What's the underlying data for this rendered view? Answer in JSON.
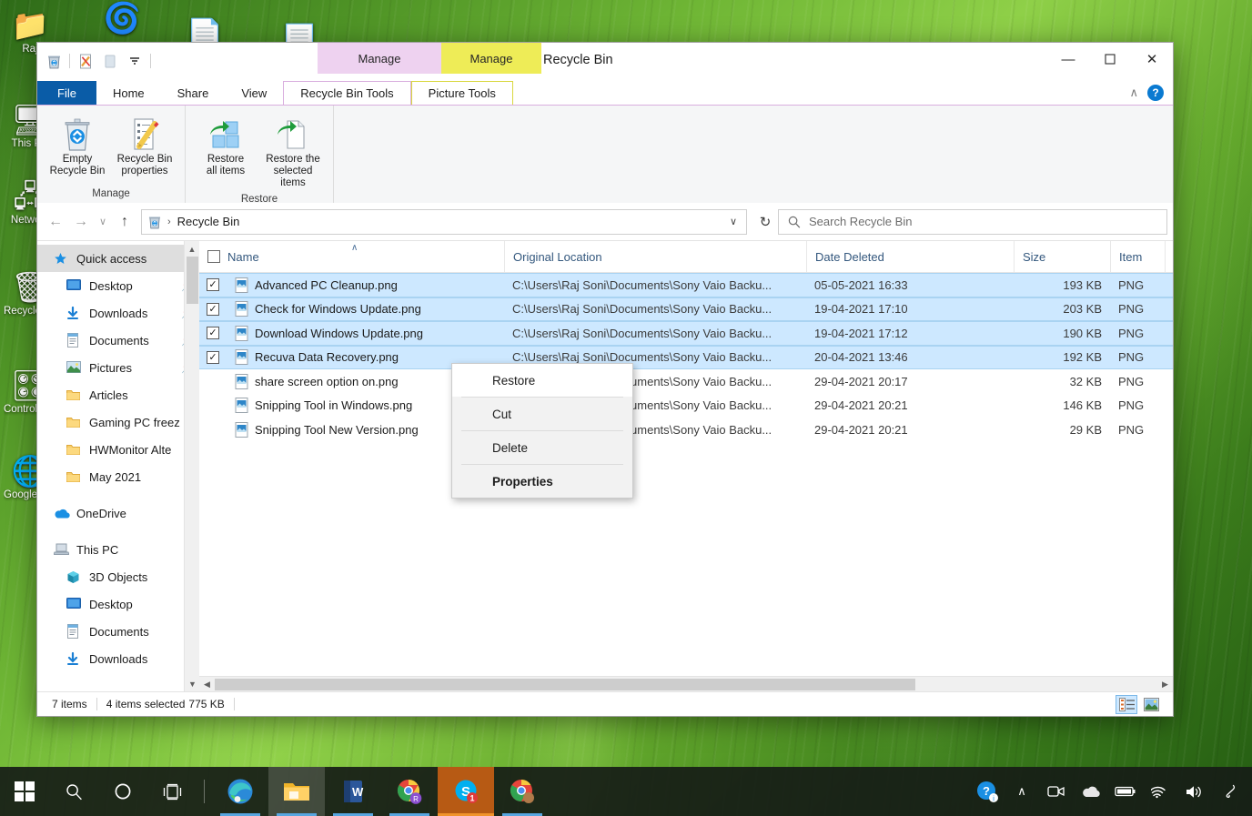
{
  "desktop": {
    "icons": [
      {
        "name": "folder-raj",
        "label": "Raj",
        "glyph": "📁"
      },
      {
        "name": "this-pc",
        "label": "This PC",
        "glyph": "🖥"
      },
      {
        "name": "network",
        "label": "Network",
        "glyph": "🖧"
      },
      {
        "name": "recycle-bin",
        "label": "Recycle Bin",
        "glyph": "🗑"
      },
      {
        "name": "control-panel",
        "label": "Control Panel",
        "glyph": "🎛"
      },
      {
        "name": "google-chrome",
        "label": "Google Chrome",
        "glyph": "🌐"
      }
    ],
    "top_icons": [
      {
        "name": "microsoft-edge",
        "label": "",
        "glyph": "🌀"
      },
      {
        "name": "document-thumbnail-1",
        "label": "",
        "glyph": "📄"
      },
      {
        "name": "document-thumbnail-2",
        "label": "",
        "glyph": "📃"
      }
    ]
  },
  "window": {
    "title": "Recycle Bin",
    "quick_access_toolbar": [
      {
        "name": "recycle-bin-icon",
        "tooltip": "Recycle Bin"
      },
      {
        "name": "properties-icon",
        "tooltip": "Properties"
      },
      {
        "name": "new-folder-icon",
        "tooltip": "New folder"
      },
      {
        "name": "customize-quick-access-icon",
        "tooltip": "Customize Quick Access Toolbar"
      }
    ],
    "controls": {
      "minimize": "—",
      "maximize": "☐",
      "close": "✕"
    },
    "contextual_groups": [
      {
        "label": "Manage",
        "color": "#eed2f0"
      },
      {
        "label": "Manage",
        "color": "#eeec57"
      }
    ],
    "tabs": [
      {
        "label": "File",
        "state": "file"
      },
      {
        "label": "Home",
        "state": "normal"
      },
      {
        "label": "Share",
        "state": "normal"
      },
      {
        "label": "View",
        "state": "normal"
      },
      {
        "label": "Recycle Bin Tools",
        "state": "active-pink"
      },
      {
        "label": "Picture Tools",
        "state": "active-yellow"
      }
    ],
    "ribbon_collapse": "∧",
    "help": "?"
  },
  "ribbon": {
    "groups": [
      {
        "name": "Manage",
        "buttons": [
          {
            "name": "empty-recycle-bin-button",
            "line1": "Empty",
            "line2": "Recycle Bin",
            "icon": "recycle-bin-icon"
          },
          {
            "name": "recycle-bin-properties-button",
            "line1": "Recycle Bin",
            "line2": "properties",
            "icon": "properties-icon"
          }
        ]
      },
      {
        "name": "Restore",
        "buttons": [
          {
            "name": "restore-all-items-button",
            "line1": "Restore",
            "line2": "all items",
            "icon": "restore-all-icon"
          },
          {
            "name": "restore-selected-items-button",
            "line1": "Restore the",
            "line2": "selected items",
            "icon": "restore-selected-icon"
          }
        ]
      }
    ]
  },
  "address": {
    "back": "←",
    "forward": "→",
    "recent": "∨",
    "up": "↑",
    "crumb_icon": "recycle-bin-icon",
    "crumb_sep": "›",
    "crumb": "Recycle Bin",
    "dropdown": "∨",
    "refresh": "↻"
  },
  "search": {
    "placeholder": "Search Recycle Bin",
    "value": "",
    "icon": "search-icon"
  },
  "nav_pane": {
    "items": [
      {
        "name": "sidebar-item-quick-access",
        "label": "Quick access",
        "icon": "star-pin-icon",
        "level": 0,
        "selected": true,
        "pinned": false
      },
      {
        "name": "sidebar-item-desktop",
        "label": "Desktop",
        "icon": "desktop-icon",
        "level": 1,
        "selected": false,
        "pinned": true
      },
      {
        "name": "sidebar-item-downloads",
        "label": "Downloads",
        "icon": "download-icon",
        "level": 1,
        "selected": false,
        "pinned": true
      },
      {
        "name": "sidebar-item-documents",
        "label": "Documents",
        "icon": "documents-icon",
        "level": 1,
        "selected": false,
        "pinned": true
      },
      {
        "name": "sidebar-item-pictures",
        "label": "Pictures",
        "icon": "pictures-icon",
        "level": 1,
        "selected": false,
        "pinned": true
      },
      {
        "name": "sidebar-item-articles",
        "label": "Articles",
        "icon": "folder-icon",
        "level": 1,
        "selected": false,
        "pinned": false
      },
      {
        "name": "sidebar-item-gaming-pc-freez",
        "label": "Gaming PC freez",
        "icon": "folder-icon",
        "level": 1,
        "selected": false,
        "pinned": false
      },
      {
        "name": "sidebar-item-hwmonitor-alte",
        "label": "HWMonitor Alte",
        "icon": "folder-icon",
        "level": 1,
        "selected": false,
        "pinned": false
      },
      {
        "name": "sidebar-item-may-2021",
        "label": "May 2021",
        "icon": "folder-icon",
        "level": 1,
        "selected": false,
        "pinned": false
      },
      {
        "name": "sidebar-item-onedrive",
        "label": "OneDrive",
        "icon": "onedrive-icon",
        "level": 0,
        "selected": false,
        "pinned": false,
        "spacer": true
      },
      {
        "name": "sidebar-item-this-pc",
        "label": "This PC",
        "icon": "this-pc-icon",
        "level": 0,
        "selected": false,
        "pinned": false,
        "spacer": true
      },
      {
        "name": "sidebar-item-3d-objects",
        "label": "3D Objects",
        "icon": "3d-objects-icon",
        "level": 1,
        "selected": false,
        "pinned": false
      },
      {
        "name": "sidebar-item-desktop-pc",
        "label": "Desktop",
        "icon": "desktop-icon",
        "level": 1,
        "selected": false,
        "pinned": false
      },
      {
        "name": "sidebar-item-documents-pc",
        "label": "Documents",
        "icon": "documents-icon",
        "level": 1,
        "selected": false,
        "pinned": false
      },
      {
        "name": "sidebar-item-downloads-pc",
        "label": "Downloads",
        "icon": "download-icon",
        "level": 1,
        "selected": false,
        "pinned": false
      }
    ]
  },
  "file_list": {
    "columns": [
      {
        "name": "column-name",
        "label": "Name",
        "sorted": true
      },
      {
        "name": "column-original-location",
        "label": "Original Location",
        "sorted": false
      },
      {
        "name": "column-date-deleted",
        "label": "Date Deleted",
        "sorted": false
      },
      {
        "name": "column-size",
        "label": "Size",
        "sorted": false
      },
      {
        "name": "column-item-type",
        "label": "Item",
        "sorted": false
      }
    ],
    "rows": [
      {
        "name": "Advanced PC Cleanup.png",
        "location": "C:\\Users\\Raj Soni\\Documents\\Sony Vaio Backu...",
        "date": "05-05-2021 16:33",
        "size": "193 KB",
        "type": "PNG",
        "selected": true,
        "checked": true
      },
      {
        "name": "Check for Windows Update.png",
        "location": "C:\\Users\\Raj Soni\\Documents\\Sony Vaio Backu...",
        "date": "19-04-2021 17:10",
        "size": "203 KB",
        "type": "PNG",
        "selected": true,
        "checked": true
      },
      {
        "name": "Download Windows Update.png",
        "location": "C:\\Users\\Raj Soni\\Documents\\Sony Vaio Backu...",
        "date": "19-04-2021 17:12",
        "size": "190 KB",
        "type": "PNG",
        "selected": true,
        "checked": true
      },
      {
        "name": "Recuva Data Recovery.png",
        "location": "C:\\Users\\Raj Soni\\Documents\\Sony Vaio Backu...",
        "date": "20-04-2021 13:46",
        "size": "192 KB",
        "type": "PNG",
        "selected": true,
        "checked": true
      },
      {
        "name": "share screen option on.png",
        "location": "C:\\Users\\Raj Soni\\Documents\\Sony Vaio Backu...",
        "date": "29-04-2021 20:17",
        "size": "32 KB",
        "type": "PNG",
        "selected": false,
        "checked": false
      },
      {
        "name": "Snipping Tool in Windows.png",
        "location": "C:\\Users\\Raj Soni\\Documents\\Sony Vaio Backu...",
        "date": "29-04-2021 20:21",
        "size": "146 KB",
        "type": "PNG",
        "selected": false,
        "checked": false
      },
      {
        "name": "Snipping Tool New Version.png",
        "location": "C:\\Users\\Raj Soni\\Documents\\Sony Vaio Backu...",
        "date": "29-04-2021 20:21",
        "size": "29 KB",
        "type": "PNG",
        "selected": false,
        "checked": false
      }
    ]
  },
  "context_menu": {
    "items": [
      {
        "name": "context-menu-restore",
        "label": "Restore",
        "bold": false,
        "highlighted": true
      },
      {
        "name": "context-menu-cut",
        "label": "Cut",
        "bold": false,
        "highlighted": false
      },
      {
        "name": "context-menu-delete",
        "label": "Delete",
        "bold": false,
        "highlighted": false
      },
      {
        "name": "context-menu-properties",
        "label": "Properties",
        "bold": true,
        "highlighted": false
      }
    ]
  },
  "status_bar": {
    "item_count": "7 items",
    "selection": "4 items selected",
    "selection_size": "775 KB",
    "views": [
      {
        "name": "details-view-button",
        "label": "Details view",
        "active": true
      },
      {
        "name": "large-icons-view-button",
        "label": "Large icons view",
        "active": false
      }
    ]
  },
  "taskbar": {
    "start": {
      "name": "start-button",
      "label": "Start"
    },
    "buttons": [
      {
        "name": "search-taskbar-icon",
        "label": "Search",
        "glyph": "search"
      },
      {
        "name": "cortana-icon",
        "label": "Cortana",
        "glyph": "circle"
      },
      {
        "name": "task-view-icon",
        "label": "Task View",
        "glyph": "taskview"
      }
    ],
    "apps": [
      {
        "name": "taskbar-microsoft-edge",
        "label": "Microsoft Edge",
        "active": false,
        "running": true,
        "highlight": "none"
      },
      {
        "name": "taskbar-file-explorer",
        "label": "File Explorer",
        "active": true,
        "running": true,
        "highlight": "grey"
      },
      {
        "name": "taskbar-word",
        "label": "Word",
        "active": false,
        "running": true,
        "highlight": "none"
      },
      {
        "name": "taskbar-chrome-profile-r",
        "label": "Google Chrome",
        "active": false,
        "running": true,
        "highlight": "none"
      },
      {
        "name": "taskbar-skype",
        "label": "Skype",
        "active": false,
        "running": true,
        "highlight": "orange",
        "badge": "1"
      },
      {
        "name": "taskbar-chrome-profile-2",
        "label": "Google Chrome",
        "active": false,
        "running": true,
        "highlight": "none"
      }
    ],
    "tray": [
      {
        "name": "get-help-icon",
        "label": "Get Help"
      },
      {
        "name": "show-hidden-icons",
        "label": "Show hidden icons",
        "glyph": "∧"
      },
      {
        "name": "meet-now-icon",
        "label": "Meet Now"
      },
      {
        "name": "onedrive-tray-icon",
        "label": "OneDrive"
      },
      {
        "name": "battery-icon",
        "label": "Battery"
      },
      {
        "name": "network-icon",
        "label": "Network"
      },
      {
        "name": "volume-icon",
        "label": "Volume"
      },
      {
        "name": "pen-icon",
        "label": "Windows Ink Workspace"
      }
    ]
  },
  "colors": {
    "accent": "#0a5ca7",
    "selection": "#cde8ff",
    "contextual_pink": "#eed2f0",
    "contextual_yellow": "#eeec57",
    "taskbar": "#171d17"
  }
}
